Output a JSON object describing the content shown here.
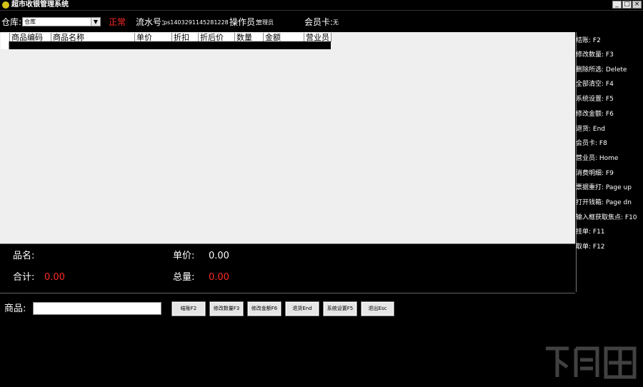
{
  "window": {
    "title": "超市收银管理系统",
    "buttons": [
      "_",
      "□",
      "×"
    ]
  },
  "info_bar": {
    "warehouse_label": "仓库:",
    "warehouse_value": "仓库",
    "status": "正常",
    "serial_label": "流水号:",
    "serial_value": "ps1403291145281228",
    "operator_label": "操作员:",
    "operator_value": "管理员",
    "member_label": "会员卡:",
    "member_value": "无"
  },
  "table": {
    "columns": [
      "商品编码",
      "商品名称",
      "单价",
      "折扣",
      "折后价",
      "数量",
      "金额",
      "营业员"
    ]
  },
  "shortcuts": [
    "结账: F2",
    "修改数量: F3",
    "删除所选: Delete",
    "全部清空: F4",
    "系统设置: F5",
    "修改金额: F6",
    "退货: End",
    "会员卡: F8",
    "营业员: Home",
    "消费明细: F9",
    "票据重打: Page up",
    "打开钱箱: Page dn",
    "输入框获取焦点: F10",
    "挂单: F11",
    "取单: F12"
  ],
  "summary": {
    "name_label": "品名:",
    "name_value": "",
    "price_label": "单价:",
    "price_value": "0.00",
    "total_label": "合计:",
    "total_value": "0.00",
    "qty_label": "总量:",
    "qty_value": "0.00"
  },
  "bottom": {
    "product_label": "商品:",
    "product_value": "",
    "buttons": [
      "结账F2",
      "修改数量F3",
      "修改金额F6",
      "退货End",
      "系统设置F5",
      "退出Esc"
    ]
  },
  "colors": {
    "background": "#000000",
    "accent_red": "#ff2a2a",
    "panel": "#efefef"
  }
}
